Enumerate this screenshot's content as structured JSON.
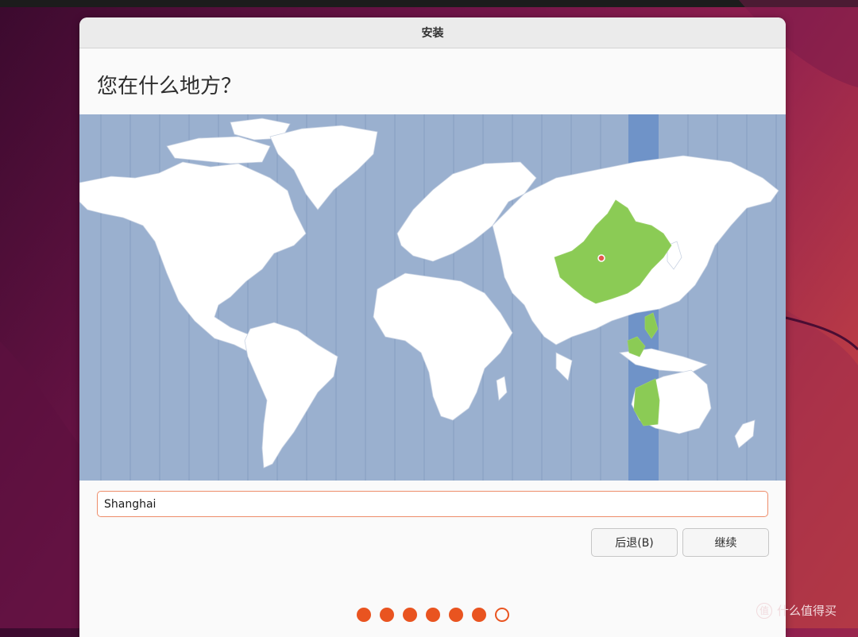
{
  "window": {
    "title": "安装"
  },
  "page": {
    "heading": "您在什么地方？"
  },
  "location": {
    "value": "Shanghai"
  },
  "buttons": {
    "back": "后退(B)",
    "continue": "继续"
  },
  "progress": {
    "total_steps": 7,
    "completed_steps": 6
  },
  "map": {
    "selected_timezone_color": "#6f93c8",
    "selected_region_color": "#8bcb55",
    "marker_color": "#e4574e"
  },
  "watermark": {
    "text": "什么值得买",
    "icon_label": "值"
  }
}
